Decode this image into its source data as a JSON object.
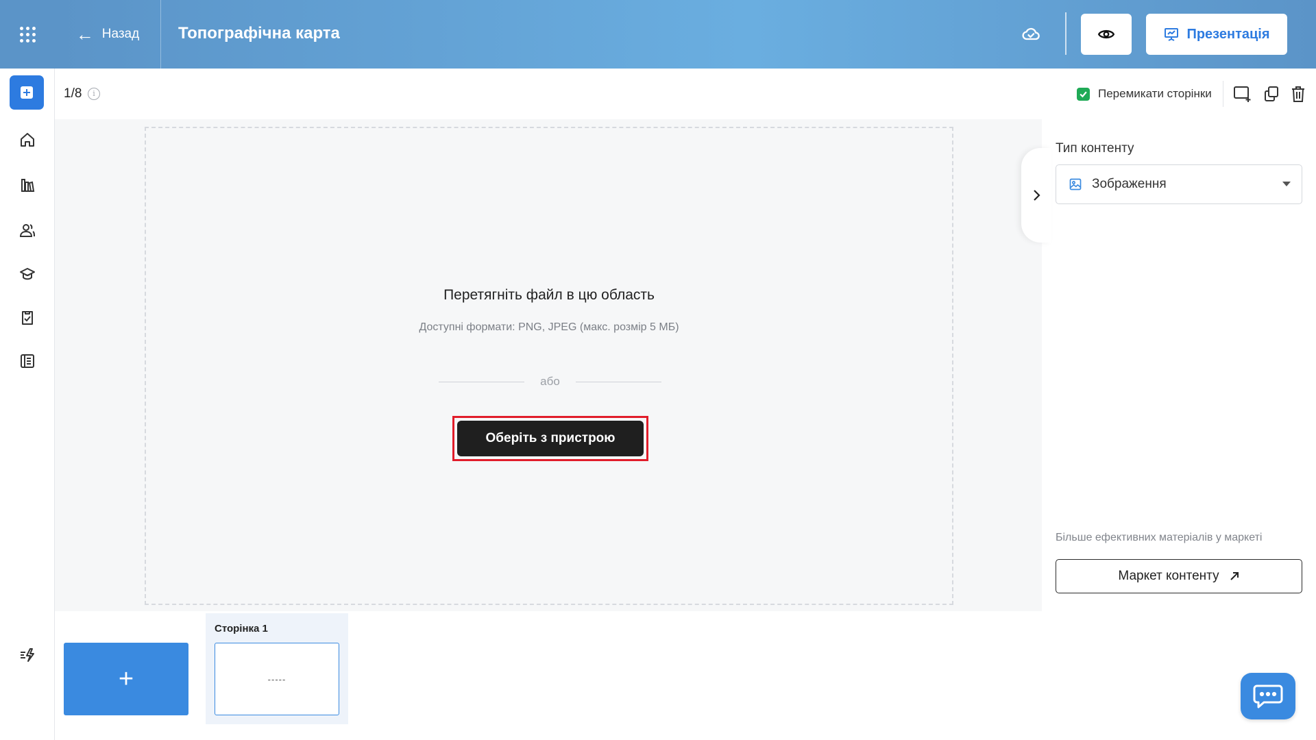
{
  "header": {
    "back_label": "Назад",
    "title": "Топографічна карта",
    "presentation_label": "Презентація"
  },
  "toolbar": {
    "page_counter": "1/8",
    "switch_pages_label": "Перемикати сторінки",
    "switch_pages_checked": true
  },
  "rail": {
    "items": [
      "add-icon",
      "home-icon",
      "library-icon",
      "users-icon",
      "courses-icon",
      "tasks-icon",
      "journal-icon",
      "actions-icon"
    ]
  },
  "dropzone": {
    "title": "Перетягніть файл в цю область",
    "formats": "Доступні формати: PNG, JPEG (макс. розмір 5 МБ)",
    "or_label": "або",
    "select_button": "Оберіть з пристрою"
  },
  "right_panel": {
    "content_type_label": "Тип контенту",
    "content_type_value": "Зображення",
    "market_hint": "Більше ефективних матеріалів у маркеті",
    "market_button": "Маркет контенту"
  },
  "pages": {
    "add_label": "+",
    "items": [
      {
        "label": "Сторінка 1",
        "thumb_text": "-----"
      }
    ]
  },
  "colors": {
    "header_blue": "#5b94c8",
    "accent_blue": "#2d7be0",
    "highlight_red": "#e11d2a",
    "check_green": "#1faa56"
  }
}
